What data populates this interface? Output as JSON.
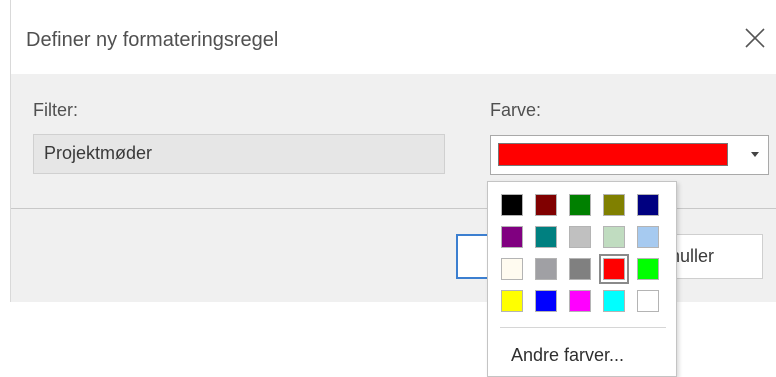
{
  "dialog": {
    "title": "Definer ny formateringsregel"
  },
  "filter": {
    "label": "Filter:",
    "value": "Projektmøder"
  },
  "color": {
    "label": "Farve:",
    "selected": "#ff0000"
  },
  "footer": {
    "ok_label": "",
    "cancel_label": "nuller"
  },
  "palette": {
    "swatches": [
      "#000000",
      "#800000",
      "#008000",
      "#808000",
      "#000080",
      "#800080",
      "#008080",
      "#c0c0c0",
      "#c0dcc0",
      "#a6caf0",
      "#fffbf0",
      "#a0a0a4",
      "#808080",
      "#ff0000",
      "#00ff00",
      "#ffff00",
      "#0000ff",
      "#ff00ff",
      "#00ffff",
      "#ffffff"
    ],
    "selected_index": 13,
    "more_colors_label": "Andre farver..."
  }
}
